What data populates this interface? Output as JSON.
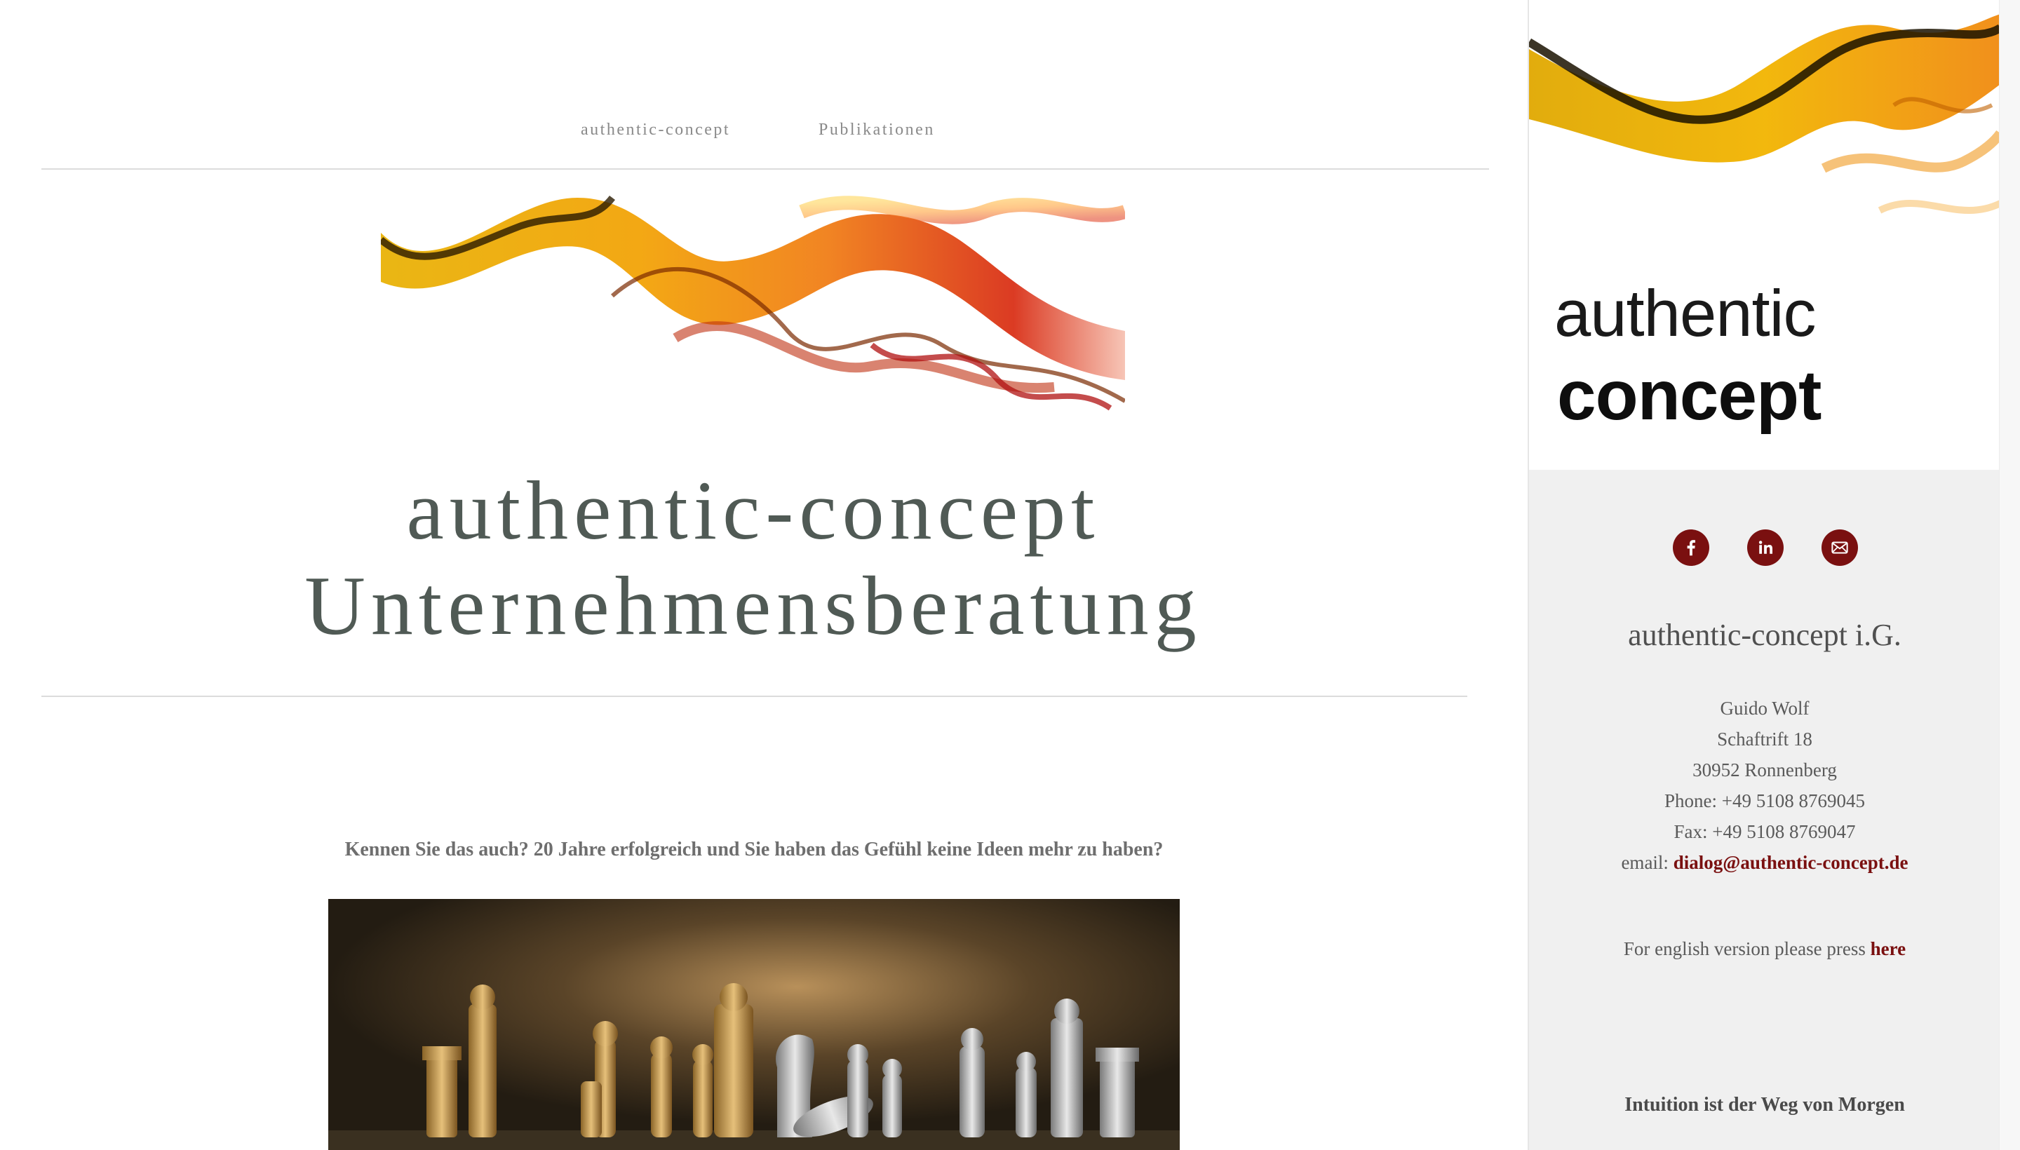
{
  "nav": {
    "items": [
      {
        "label": "authentic-concept"
      },
      {
        "label": "Publikationen"
      }
    ]
  },
  "site": {
    "title_line1": "authentic-concept",
    "title_line2": "Unternehmensberatung"
  },
  "content": {
    "intro": "Kennen Sie das auch? 20 Jahre erfolgreich und Sie haben das Gefühl keine Ideen mehr zu haben?"
  },
  "sidebar": {
    "logo": {
      "word1": "authentic",
      "word2": "concept"
    },
    "social": [
      {
        "icon": "facebook-icon"
      },
      {
        "icon": "linkedin-icon"
      },
      {
        "icon": "email-icon"
      }
    ],
    "company": "authentic-concept i.G.",
    "address": {
      "name": "Guido Wolf",
      "street": "Schaftrift 18",
      "city": "30952 Ronnenberg",
      "phone": "Phone: +49 5108 8769045",
      "fax": "Fax: +49 5108 8769047",
      "email_label": "email: ",
      "email": "dialog@authentic-concept.de"
    },
    "english": {
      "text": "For english version please press ",
      "link": "here"
    },
    "motto": "Intuition ist der Weg von Morgen"
  },
  "colors": {
    "accent": "#7a1010",
    "title": "#505a55",
    "sidebar_bg": "#f0f0f0"
  }
}
